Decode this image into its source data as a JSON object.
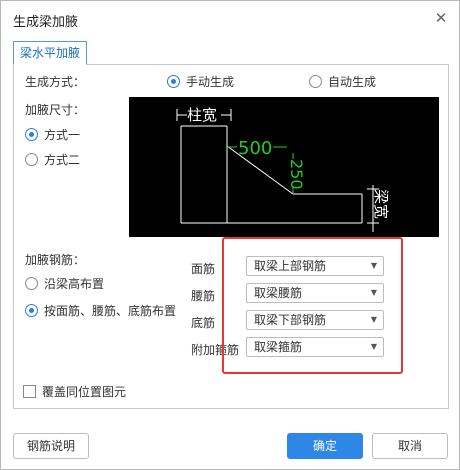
{
  "dialog": {
    "title": "生成梁加腋",
    "close_glyph": "✕"
  },
  "tab": {
    "label": "梁水平加腋"
  },
  "generation": {
    "label": "生成方式：",
    "options": [
      "手动生成",
      "自动生成"
    ],
    "selected": "手动生成"
  },
  "size": {
    "label": "加腋尺寸：",
    "options": [
      "方式一",
      "方式二"
    ],
    "selected": "方式一"
  },
  "preview": {
    "column_width_label": "柱宽",
    "dim_horizontal": "500",
    "dim_vertical": "250",
    "beam_width_label": "梁宽",
    "colors": {
      "background": "#000000",
      "lines": "#ffffff",
      "dims": "#22cc22"
    }
  },
  "rebar": {
    "label": "加腋钢筋：",
    "options": [
      "沿梁高布置",
      "按面筋、腰筋、底筋布置"
    ],
    "selected": "按面筋、腰筋、底筋布置",
    "fields": [
      {
        "label": "面筋",
        "value": "取梁上部钢筋"
      },
      {
        "label": "腰筋",
        "value": "取梁腰筋"
      },
      {
        "label": "底筋",
        "value": "取梁下部钢筋"
      },
      {
        "label": "附加箍筋",
        "value": "取梁箍筋"
      }
    ]
  },
  "cover": {
    "label": "覆盖同位置图元",
    "checked": false
  },
  "buttons": {
    "help": "钢筋说明",
    "ok": "确定",
    "cancel": "取消"
  },
  "colors": {
    "accent": "#2e86e6",
    "highlight": "#e53935"
  }
}
